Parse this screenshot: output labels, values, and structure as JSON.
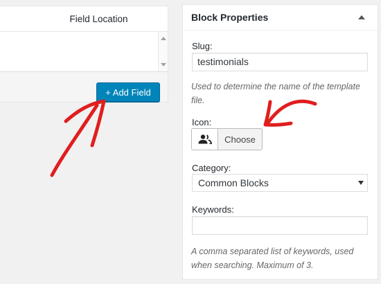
{
  "left_panel": {
    "header": "Field Location",
    "add_field_label": "+ Add Field"
  },
  "block_properties": {
    "title": "Block Properties",
    "slug": {
      "label": "Slug:",
      "value": "testimonials",
      "description": "Used to determine the name of the template file."
    },
    "icon": {
      "label": "Icon:",
      "selected_icon": "groups-icon",
      "choose_label": "Choose"
    },
    "category": {
      "label": "Category:",
      "selected": "Common Blocks"
    },
    "keywords": {
      "label": "Keywords:",
      "value": "",
      "description": "A comma separated list of keywords, used when searching. Maximum of 3."
    }
  },
  "colors": {
    "primary_button": "#0085ba",
    "annotation_arrow": "#e01e1e"
  },
  "annotations": [
    {
      "type": "hand-drawn-arrow",
      "points_to": "add-field-button"
    },
    {
      "type": "hand-drawn-arrow",
      "points_to": "icon-choose-button"
    }
  ]
}
